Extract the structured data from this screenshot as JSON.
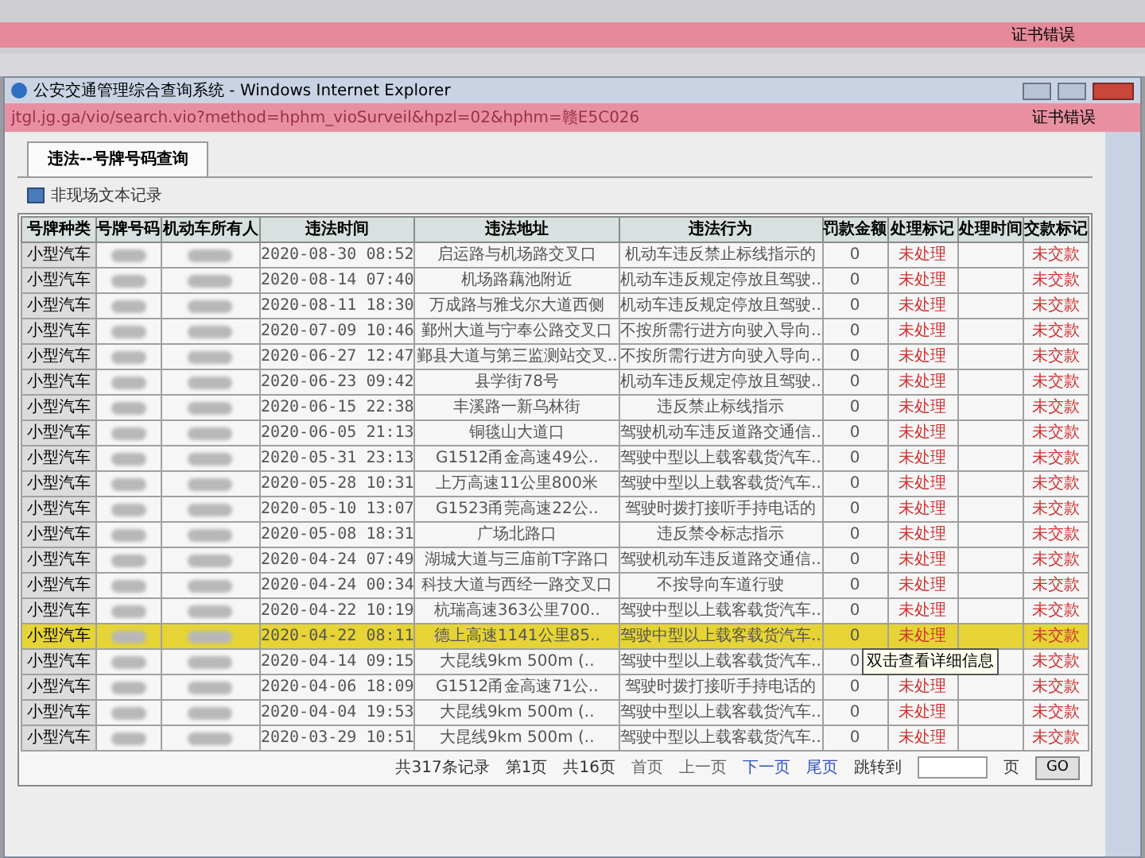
{
  "browser_bar": {
    "cert_error": "证书错误"
  },
  "window": {
    "title": "公安交通管理综合查询系统 - Windows Internet Explorer"
  },
  "address_bar": {
    "url": "jtgl.jg.ga/vio/search.vio?method=hphm_vioSurveil&hpzl=02&hphm=赣E5C026",
    "cert_error": "证书错误"
  },
  "tabs": [
    {
      "label": "违法--号牌号码查询",
      "selected": true
    }
  ],
  "section": {
    "title": "非现场文本记录"
  },
  "table": {
    "columns": [
      "号牌种类",
      "号牌号码",
      "机动车所有人",
      "违法时间",
      "违法地址",
      "违法行为",
      "罚款金额",
      "处理标记",
      "处理时间",
      "交款标记"
    ],
    "rows": [
      {
        "plate_type": "小型汽车",
        "time": "2020-08-30 08:52",
        "address": "启运路与机场路交叉口",
        "violation": "机动车违反禁止标线指示的",
        "fine": "0",
        "handle_mark": "未处理",
        "pay_mark": "未交款",
        "selected": false
      },
      {
        "plate_type": "小型汽车",
        "time": "2020-08-14 07:40",
        "address": "机场路藕池附近",
        "violation": "机动车违反规定停放且驾驶..",
        "fine": "0",
        "handle_mark": "未处理",
        "pay_mark": "未交款",
        "selected": false
      },
      {
        "plate_type": "小型汽车",
        "time": "2020-08-11 18:30",
        "address": "万成路与雅戈尔大道西侧",
        "violation": "机动车违反规定停放且驾驶..",
        "fine": "0",
        "handle_mark": "未处理",
        "pay_mark": "未交款",
        "selected": false
      },
      {
        "plate_type": "小型汽车",
        "time": "2020-07-09 10:46",
        "address": "鄞州大道与宁奉公路交叉口",
        "violation": "不按所需行进方向驶入导向..",
        "fine": "0",
        "handle_mark": "未处理",
        "pay_mark": "未交款",
        "selected": false
      },
      {
        "plate_type": "小型汽车",
        "time": "2020-06-27 12:47",
        "address": "鄞县大道与第三监测站交叉..",
        "violation": "不按所需行进方向驶入导向..",
        "fine": "0",
        "handle_mark": "未处理",
        "pay_mark": "未交款",
        "selected": false
      },
      {
        "plate_type": "小型汽车",
        "time": "2020-06-23 09:42",
        "address": "县学街78号",
        "violation": "机动车违反规定停放且驾驶..",
        "fine": "0",
        "handle_mark": "未处理",
        "pay_mark": "未交款",
        "selected": false
      },
      {
        "plate_type": "小型汽车",
        "time": "2020-06-15 22:38",
        "address": "丰溪路一新乌林街",
        "violation": "违反禁止标线指示",
        "fine": "0",
        "handle_mark": "未处理",
        "pay_mark": "未交款",
        "selected": false
      },
      {
        "plate_type": "小型汽车",
        "time": "2020-06-05 21:13",
        "address": "铜毯山大道口",
        "violation": "驾驶机动车违反道路交通信..",
        "fine": "0",
        "handle_mark": "未处理",
        "pay_mark": "未交款",
        "selected": false
      },
      {
        "plate_type": "小型汽车",
        "time": "2020-05-31 23:13",
        "address": "G1512甬金高速49公..",
        "violation": "驾驶中型以上载客载货汽车..",
        "fine": "0",
        "handle_mark": "未处理",
        "pay_mark": "未交款",
        "selected": false
      },
      {
        "plate_type": "小型汽车",
        "time": "2020-05-28 10:31",
        "address": "上万高速11公里800米",
        "violation": "驾驶中型以上载客载货汽车..",
        "fine": "0",
        "handle_mark": "未处理",
        "pay_mark": "未交款",
        "selected": false
      },
      {
        "plate_type": "小型汽车",
        "time": "2020-05-10 13:07",
        "address": "G1523甬莞高速22公..",
        "violation": "驾驶时拨打接听手持电话的",
        "fine": "0",
        "handle_mark": "未处理",
        "pay_mark": "未交款",
        "selected": false
      },
      {
        "plate_type": "小型汽车",
        "time": "2020-05-08 18:31",
        "address": "广场北路口",
        "violation": "违反禁令标志指示",
        "fine": "0",
        "handle_mark": "未处理",
        "pay_mark": "未交款",
        "selected": false
      },
      {
        "plate_type": "小型汽车",
        "time": "2020-04-24 07:49",
        "address": "湖城大道与三庙前T字路口",
        "violation": "驾驶机动车违反道路交通信..",
        "fine": "0",
        "handle_mark": "未处理",
        "pay_mark": "未交款",
        "selected": false
      },
      {
        "plate_type": "小型汽车",
        "time": "2020-04-24 00:34",
        "address": "科技大道与西经一路交叉口",
        "violation": "不按导向车道行驶",
        "fine": "0",
        "handle_mark": "未处理",
        "pay_mark": "未交款",
        "selected": false
      },
      {
        "plate_type": "小型汽车",
        "time": "2020-04-22 10:19",
        "address": "杭瑞高速363公里700..",
        "violation": "驾驶中型以上载客载货汽车..",
        "fine": "0",
        "handle_mark": "未处理",
        "pay_mark": "未交款",
        "selected": false
      },
      {
        "plate_type": "小型汽车",
        "time": "2020-04-22 08:11",
        "address": "德上高速1141公里85..",
        "violation": "驾驶中型以上载客载货汽车..",
        "fine": "0",
        "handle_mark": "未处理",
        "pay_mark": "未交款",
        "selected": true
      },
      {
        "plate_type": "小型汽车",
        "time": "2020-04-14 09:15",
        "address": "大昆线9km 500m (..",
        "violation": "驾驶中型以上载客载货汽车..",
        "fine": "0",
        "pay_mark": "未交款",
        "selected": false
      },
      {
        "plate_type": "小型汽车",
        "time": "2020-04-06 18:09",
        "address": "G1512甬金高速71公..",
        "violation": "驾驶时拨打接听手持电话的",
        "fine": "0",
        "handle_mark": "未处理",
        "pay_mark": "未交款",
        "selected": false
      },
      {
        "plate_type": "小型汽车",
        "time": "2020-04-04 19:53",
        "address": "大昆线9km 500m (..",
        "violation": "驾驶中型以上载客载货汽车..",
        "fine": "0",
        "handle_mark": "未处理",
        "pay_mark": "未交款",
        "selected": false
      },
      {
        "plate_type": "小型汽车",
        "time": "2020-03-29 10:51",
        "address": "大昆线9km 500m (..",
        "violation": "驾驶中型以上载客载货汽车..",
        "fine": "0",
        "handle_mark": "未处理",
        "pay_mark": "未交款",
        "selected": false
      }
    ]
  },
  "tooltip": {
    "text": "双击查看详细信息"
  },
  "pager": {
    "items": [
      {
        "kind": "text",
        "label": "共317条记录"
      },
      {
        "kind": "text",
        "label": "第1页"
      },
      {
        "kind": "text",
        "label": "共16页"
      },
      {
        "kind": "link",
        "label": "首页",
        "disabled": true
      },
      {
        "kind": "link",
        "label": "上一页",
        "disabled": true
      },
      {
        "kind": "link",
        "label": "下一页",
        "disabled": false
      },
      {
        "kind": "link",
        "label": "尾页",
        "disabled": false
      }
    ],
    "jump_label": "跳转到",
    "page_unit": "页",
    "go_button": "GO"
  }
}
